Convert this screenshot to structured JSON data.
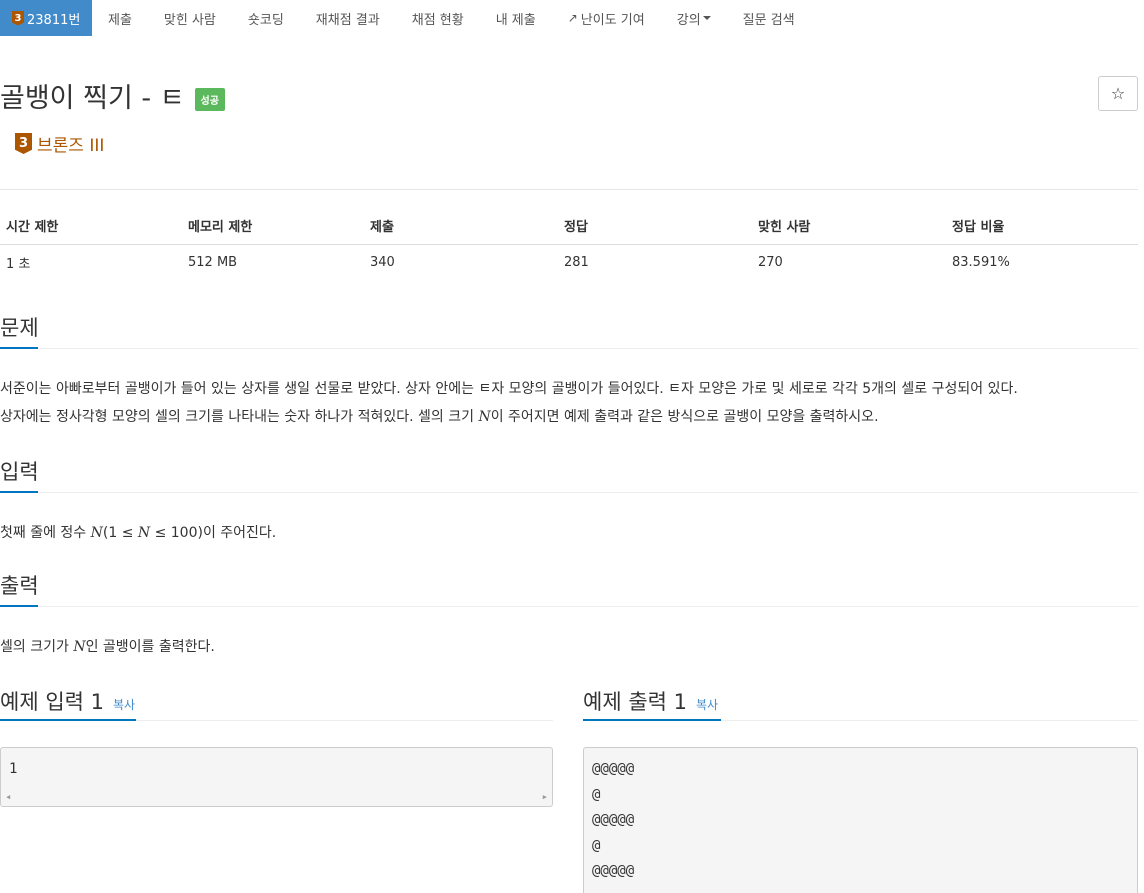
{
  "nav": {
    "problem_number": "23811번",
    "tier_digit": "3",
    "items": [
      "제출",
      "맞힌 사람",
      "숏코딩",
      "재채점 결과",
      "채점 현황",
      "내 제출",
      "난이도 기여",
      "강의",
      "질문 검색"
    ]
  },
  "header": {
    "title": "골뱅이 찍기 - ㅌ",
    "status": "성공",
    "star": "☆",
    "tier_digit": "3",
    "tier_label": "브론즈 III",
    "tier_color": "#ad5600"
  },
  "info": {
    "headers": [
      "시간 제한",
      "메모리 제한",
      "제출",
      "정답",
      "맞힌 사람",
      "정답 비율"
    ],
    "values": [
      "1 초",
      "512 MB",
      "340",
      "281",
      "270",
      "83.591%"
    ]
  },
  "sections": {
    "problem": {
      "title": "문제",
      "line1": "서준이는 아빠로부터 골뱅이가 들어 있는 상자를 생일 선물로 받았다. 상자 안에는 ㅌ자 모양의 골뱅이가 들어있다. ㅌ자 모양은 가로 및 세로로 각각 5개의 셀로 구성되어 있다.",
      "line2_a": "상자에는 정사각형 모양의 셀의 크기를 나타내는 숫자 하나가 적혀있다. 셀의 크기 ",
      "line2_var": "N",
      "line2_b": "이 주어지면 예제 출력과 같은 방식으로 골뱅이 모양을 출력하시오."
    },
    "input": {
      "title": "입력",
      "text_a": "첫째 줄에 정수 ",
      "var1": "N",
      "text_b": "(1 ≤ ",
      "var2": "N",
      "text_c": " ≤ 100)이 주어진다."
    },
    "output": {
      "title": "출력",
      "text_a": "셀의 크기가 ",
      "var": "N",
      "text_b": "인 골뱅이를 출력한다."
    }
  },
  "samples": {
    "input_title": "예제 입력 1",
    "output_title": "예제 출력 1",
    "copy_label": "복사",
    "input_text": "1",
    "output_text": "@@@@@\n@\n@@@@@\n@\n@@@@@"
  },
  "accent_color": "#428bca",
  "success_color": "#5cb85c"
}
